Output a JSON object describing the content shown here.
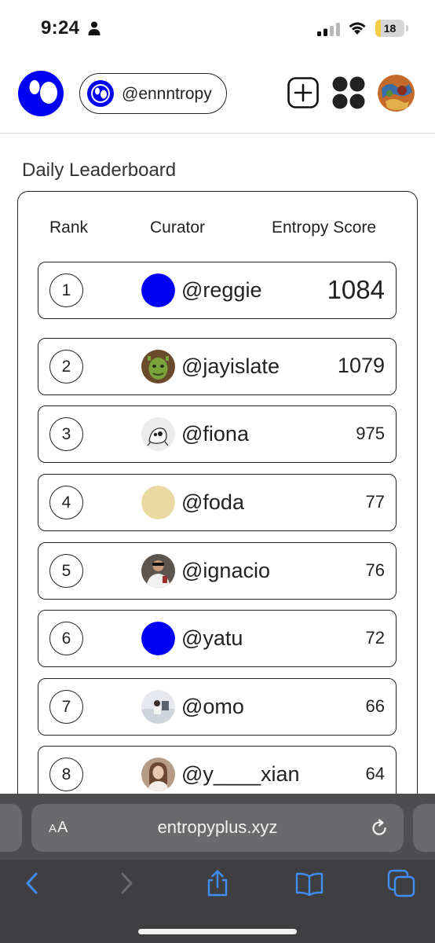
{
  "status": {
    "time": "9:24",
    "battery_level": "18",
    "battery_fraction": 0.18
  },
  "header": {
    "username": "@ennntropy"
  },
  "leaderboard": {
    "title": "Daily Leaderboard",
    "columns": {
      "rank": "Rank",
      "curator": "Curator",
      "score": "Entropy Score"
    },
    "rows": [
      {
        "rank": "1",
        "name": "@reggie",
        "score": "1084",
        "avatar": "blue-dot"
      },
      {
        "rank": "2",
        "name": "@jayislate",
        "score": "1079",
        "avatar": "photo"
      },
      {
        "rank": "3",
        "name": "@fiona",
        "score": "975",
        "avatar": "sketch"
      },
      {
        "rank": "4",
        "name": "@foda",
        "score": "77",
        "avatar": "beige-dot"
      },
      {
        "rank": "5",
        "name": "@ignacio",
        "score": "76",
        "avatar": "photo"
      },
      {
        "rank": "6",
        "name": "@yatu",
        "score": "72",
        "avatar": "blue-dot"
      },
      {
        "rank": "7",
        "name": "@omo",
        "score": "66",
        "avatar": "photo"
      },
      {
        "rank": "8",
        "name": "@y____xian",
        "score": "64",
        "avatar": "photo"
      }
    ]
  },
  "browser": {
    "aa_label_big": "A",
    "aa_label_small": "A",
    "url": "entropyplus.xyz"
  },
  "colors": {
    "brand_blue": "#0000f5",
    "beige": "#ead9a0",
    "safari_icon_blue": "#3e8ef5"
  }
}
